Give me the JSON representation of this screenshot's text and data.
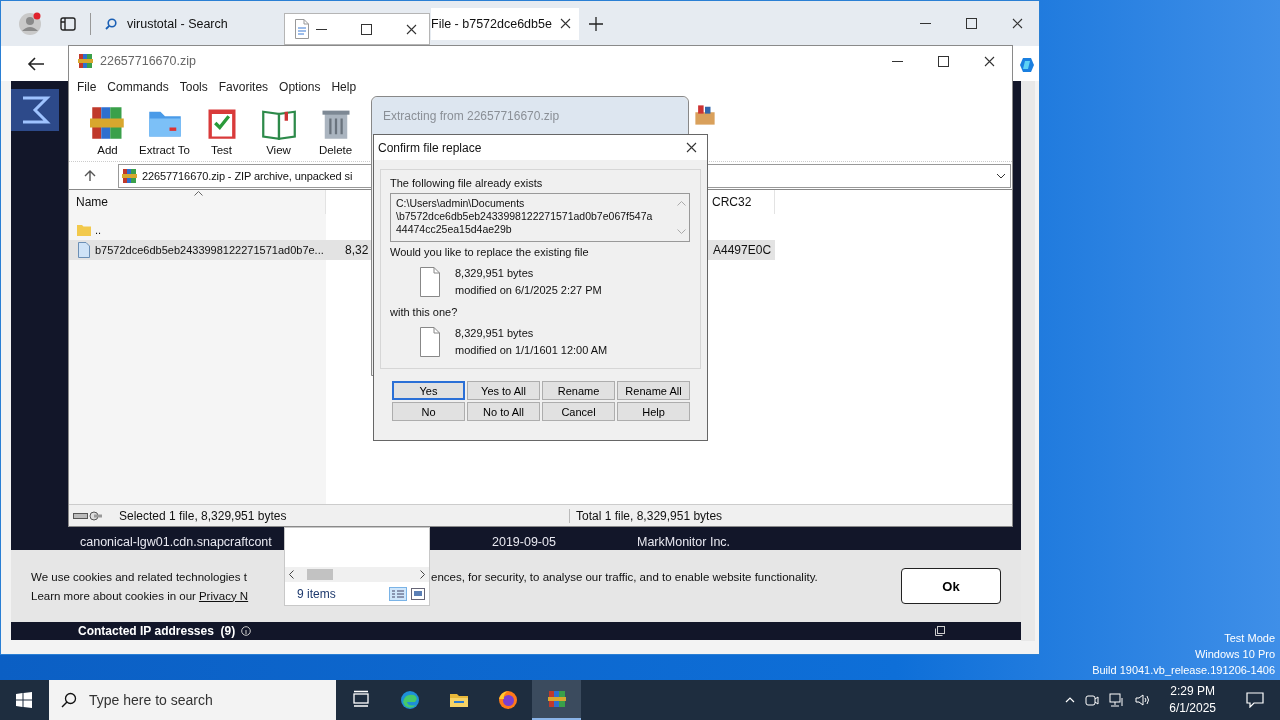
{
  "browser": {
    "tabs": [
      {
        "title": "virustotal - Search",
        "selected": false
      },
      {
        "title": "File - b7572dce6db5e",
        "selected": true
      }
    ],
    "page": {
      "rows": [
        {
          "host": "canonical-lgw01.cdn.snapcraftcont",
          "date": "2019-09-05",
          "registrar": "MarkMonitor Inc."
        }
      ],
      "cookie": {
        "line1_start": "We use cookies and related technologies t",
        "line1_end": "ences, for security, to analyse our traffic, and to enable website functionality.",
        "line2": "Learn more about cookies in our",
        "link": "Privacy N",
        "button": "Ok"
      },
      "section": "Contacted IP addresses  (9)"
    }
  },
  "mini_popup": {
    "status": "9 items"
  },
  "winrar": {
    "title": "22657716670.zip",
    "menu": [
      "File",
      "Commands",
      "Tools",
      "Favorites",
      "Options",
      "Help"
    ],
    "toolbar": [
      {
        "label": "Add",
        "kind": "add"
      },
      {
        "label": "Extract To",
        "kind": "extract"
      },
      {
        "label": "Test",
        "kind": "test"
      },
      {
        "label": "View",
        "kind": "view"
      },
      {
        "label": "Delete",
        "kind": "delete"
      }
    ],
    "address": "22657716670.zip - ZIP archive, unpacked si",
    "columns": {
      "name": "Name",
      "crc": "CRC32"
    },
    "rows": [
      {
        "kind": "folder",
        "name": "..",
        "selected": false
      },
      {
        "kind": "file",
        "name": "b7572dce6db5eb2433998122271571ad0b7e...",
        "size": "8,32",
        "crc": "A4497E0C",
        "selected": true
      }
    ],
    "status_left": "Selected 1 file, 8,329,951 bytes",
    "status_right": "Total 1 file, 8,329,951 bytes"
  },
  "progress_dialog": {
    "title": "Extracting from 22657716670.zip"
  },
  "confirm_dialog": {
    "title": "Confirm file replace",
    "exists_label": "The following file already exists",
    "path_lines": [
      "C:\\Users\\admin\\Documents",
      "\\b7572dce6db5eb2433998122271571ad0b7e067f547a",
      "44474cc25ea15d4ae29b"
    ],
    "question": "Would you like to replace the existing file",
    "existing": {
      "size": "8,329,951 bytes",
      "modified": "modified on 6/1/2025 2:27 PM"
    },
    "with_label": "with this one?",
    "incoming": {
      "size": "8,329,951 bytes",
      "modified": "modified on 1/1/1601 12:00 AM"
    },
    "buttons": [
      {
        "label": "Yes",
        "selected": true
      },
      {
        "label": "Yes to All",
        "selected": false
      },
      {
        "label": "Rename",
        "selected": false
      },
      {
        "label": "Rename All",
        "selected": false
      },
      {
        "label": "No",
        "selected": false
      },
      {
        "label": "No to All",
        "selected": false
      },
      {
        "label": "Cancel",
        "selected": false
      },
      {
        "label": "Help",
        "selected": false
      }
    ]
  },
  "system_notice": [
    "Test Mode",
    "Windows 10 Pro",
    "Build 19041.vb_release.191206-1406"
  ],
  "taskbar": {
    "search_placeholder": "Type here to search",
    "apps": [
      {
        "kind": "taskview",
        "selected": false
      },
      {
        "kind": "edge",
        "selected": false
      },
      {
        "kind": "explorer",
        "selected": false
      },
      {
        "kind": "firefox",
        "selected": false
      },
      {
        "kind": "winrar",
        "selected": true
      }
    ],
    "time": "2:29 PM",
    "date": "6/1/2025"
  }
}
